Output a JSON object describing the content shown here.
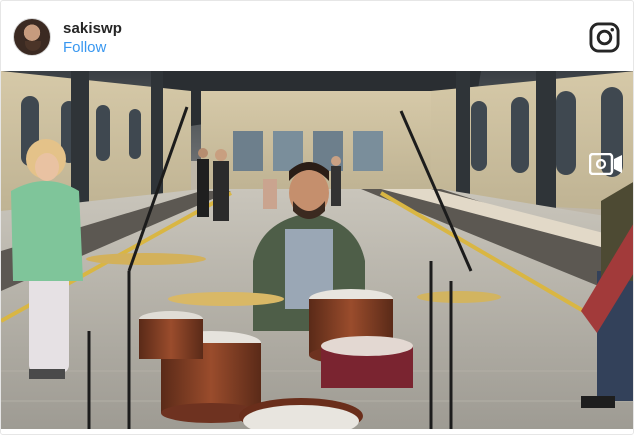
{
  "post": {
    "username": "sakiswp",
    "follow_label": "Follow"
  },
  "icons": {
    "brand": "instagram-icon",
    "media_type": "video-camera-icon",
    "avatar": "avatar"
  },
  "colors": {
    "username": "#262626",
    "follow": "#3897f0"
  }
}
